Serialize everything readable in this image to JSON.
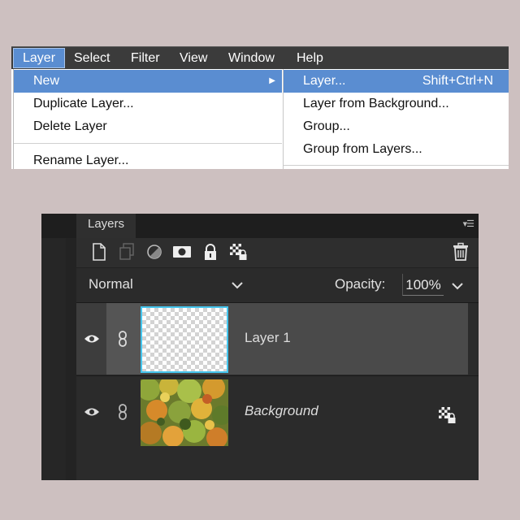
{
  "menubar": {
    "items": [
      "Layer",
      "Select",
      "Filter",
      "View",
      "Window",
      "Help"
    ]
  },
  "layer_menu": {
    "items": [
      "New",
      "Duplicate Layer...",
      "Delete Layer",
      "Rename Layer..."
    ]
  },
  "new_submenu": {
    "items": [
      {
        "label": "Layer...",
        "shortcut": "Shift+Ctrl+N"
      },
      {
        "label": "Layer from Background..."
      },
      {
        "label": "Group..."
      },
      {
        "label": "Group from Layers..."
      }
    ]
  },
  "layers_panel": {
    "tab_label": "Layers",
    "toolbar_icons": [
      "new-layer-icon",
      "new-group-icon",
      "adjustment-layer-icon",
      "layer-mask-icon",
      "lock-all-icon",
      "lock-transparency-icon",
      "trash-icon"
    ],
    "blend_mode": "Normal",
    "opacity_label": "Opacity:",
    "opacity_value": "100%",
    "layers": [
      {
        "name": "Layer 1",
        "selected": true,
        "visible": true
      },
      {
        "name": "Background",
        "selected": false,
        "visible": true,
        "locked": true
      }
    ]
  },
  "colors": {
    "highlight": "#5a8dd1",
    "selection_border": "#45c6ee",
    "panel_bg": "#2b2b2b"
  }
}
